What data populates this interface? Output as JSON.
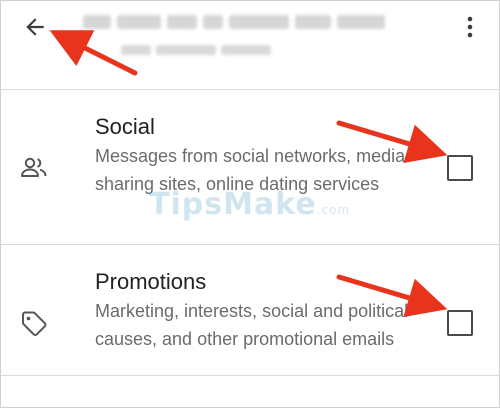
{
  "appbar": {
    "back_icon": "arrow-back-icon",
    "more_icon": "more-vert-icon"
  },
  "categories": [
    {
      "title": "Social",
      "description": "Messages from social networks, media-sharing sites, online dating services",
      "icon": "people-icon",
      "checked": false
    },
    {
      "title": "Promotions",
      "description": "Marketing, interests, social and political causes, and other promotional emails",
      "icon": "tag-icon",
      "checked": false
    }
  ],
  "watermark": {
    "text": "TipsMake",
    "suffix": ".com"
  },
  "colors": {
    "annotation_arrow": "#e8341c",
    "checkbox_border": "#4a4a4a",
    "description_text": "#6b6b6b"
  }
}
